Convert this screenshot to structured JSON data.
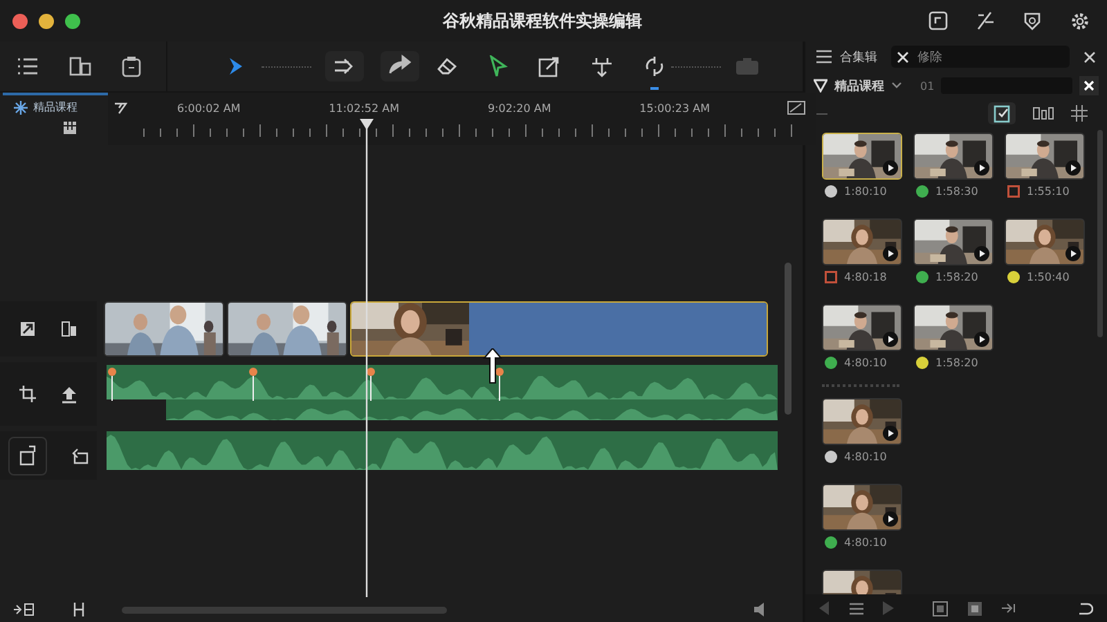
{
  "window": {
    "title": "谷秋精品课程软件实操编辑"
  },
  "library": {
    "label": "精品课程"
  },
  "ruler": {
    "times": [
      "6:00:02 AM",
      "11:02:52 AM",
      "9:02:20 AM",
      "15:00:23 AM"
    ]
  },
  "timeline": {
    "clips": [
      {
        "kind": "picture",
        "selected": false
      },
      {
        "kind": "picture",
        "selected": false
      },
      {
        "kind": "picture",
        "selected": true
      }
    ]
  },
  "browser": {
    "tabs": [
      {
        "label": "合集辑",
        "selected": true
      },
      {
        "label": "修除",
        "selected": false
      }
    ],
    "filter": {
      "label": "精品课程",
      "code": "01"
    },
    "groups": [
      {
        "kind": "grid",
        "items": [
          {
            "duration": "1:80:10",
            "color": "#c8c8c8",
            "kind": "dot",
            "selected": true
          },
          {
            "duration": "1:58:30",
            "color": "#3fae4f",
            "kind": "dot",
            "selected": false
          },
          {
            "duration": "1:55:10",
            "color": "#c0503a",
            "kind": "square",
            "selected": false
          },
          {
            "duration": "4:80:18",
            "color": "#c0503a",
            "kind": "square",
            "selected": false
          },
          {
            "duration": "1:58:20",
            "color": "#3fae4f",
            "kind": "dot",
            "selected": false
          },
          {
            "duration": "1:50:40",
            "color": "#d8d03a",
            "kind": "dot",
            "selected": false
          },
          {
            "duration": "4:80:10",
            "color": "#3fae4f",
            "kind": "dot",
            "selected": false
          },
          {
            "duration": "1:58:20",
            "color": "#d8d03a",
            "kind": "dot",
            "selected": false
          }
        ]
      },
      {
        "kind": "stack",
        "items": [
          {
            "duration": "4:80:10",
            "color": "#c8c8c8",
            "kind": "dot",
            "selected": false
          },
          {
            "duration": "4:80:10",
            "color": "#3fae4f",
            "kind": "dot",
            "selected": false
          },
          {
            "selected": false
          }
        ]
      }
    ]
  }
}
